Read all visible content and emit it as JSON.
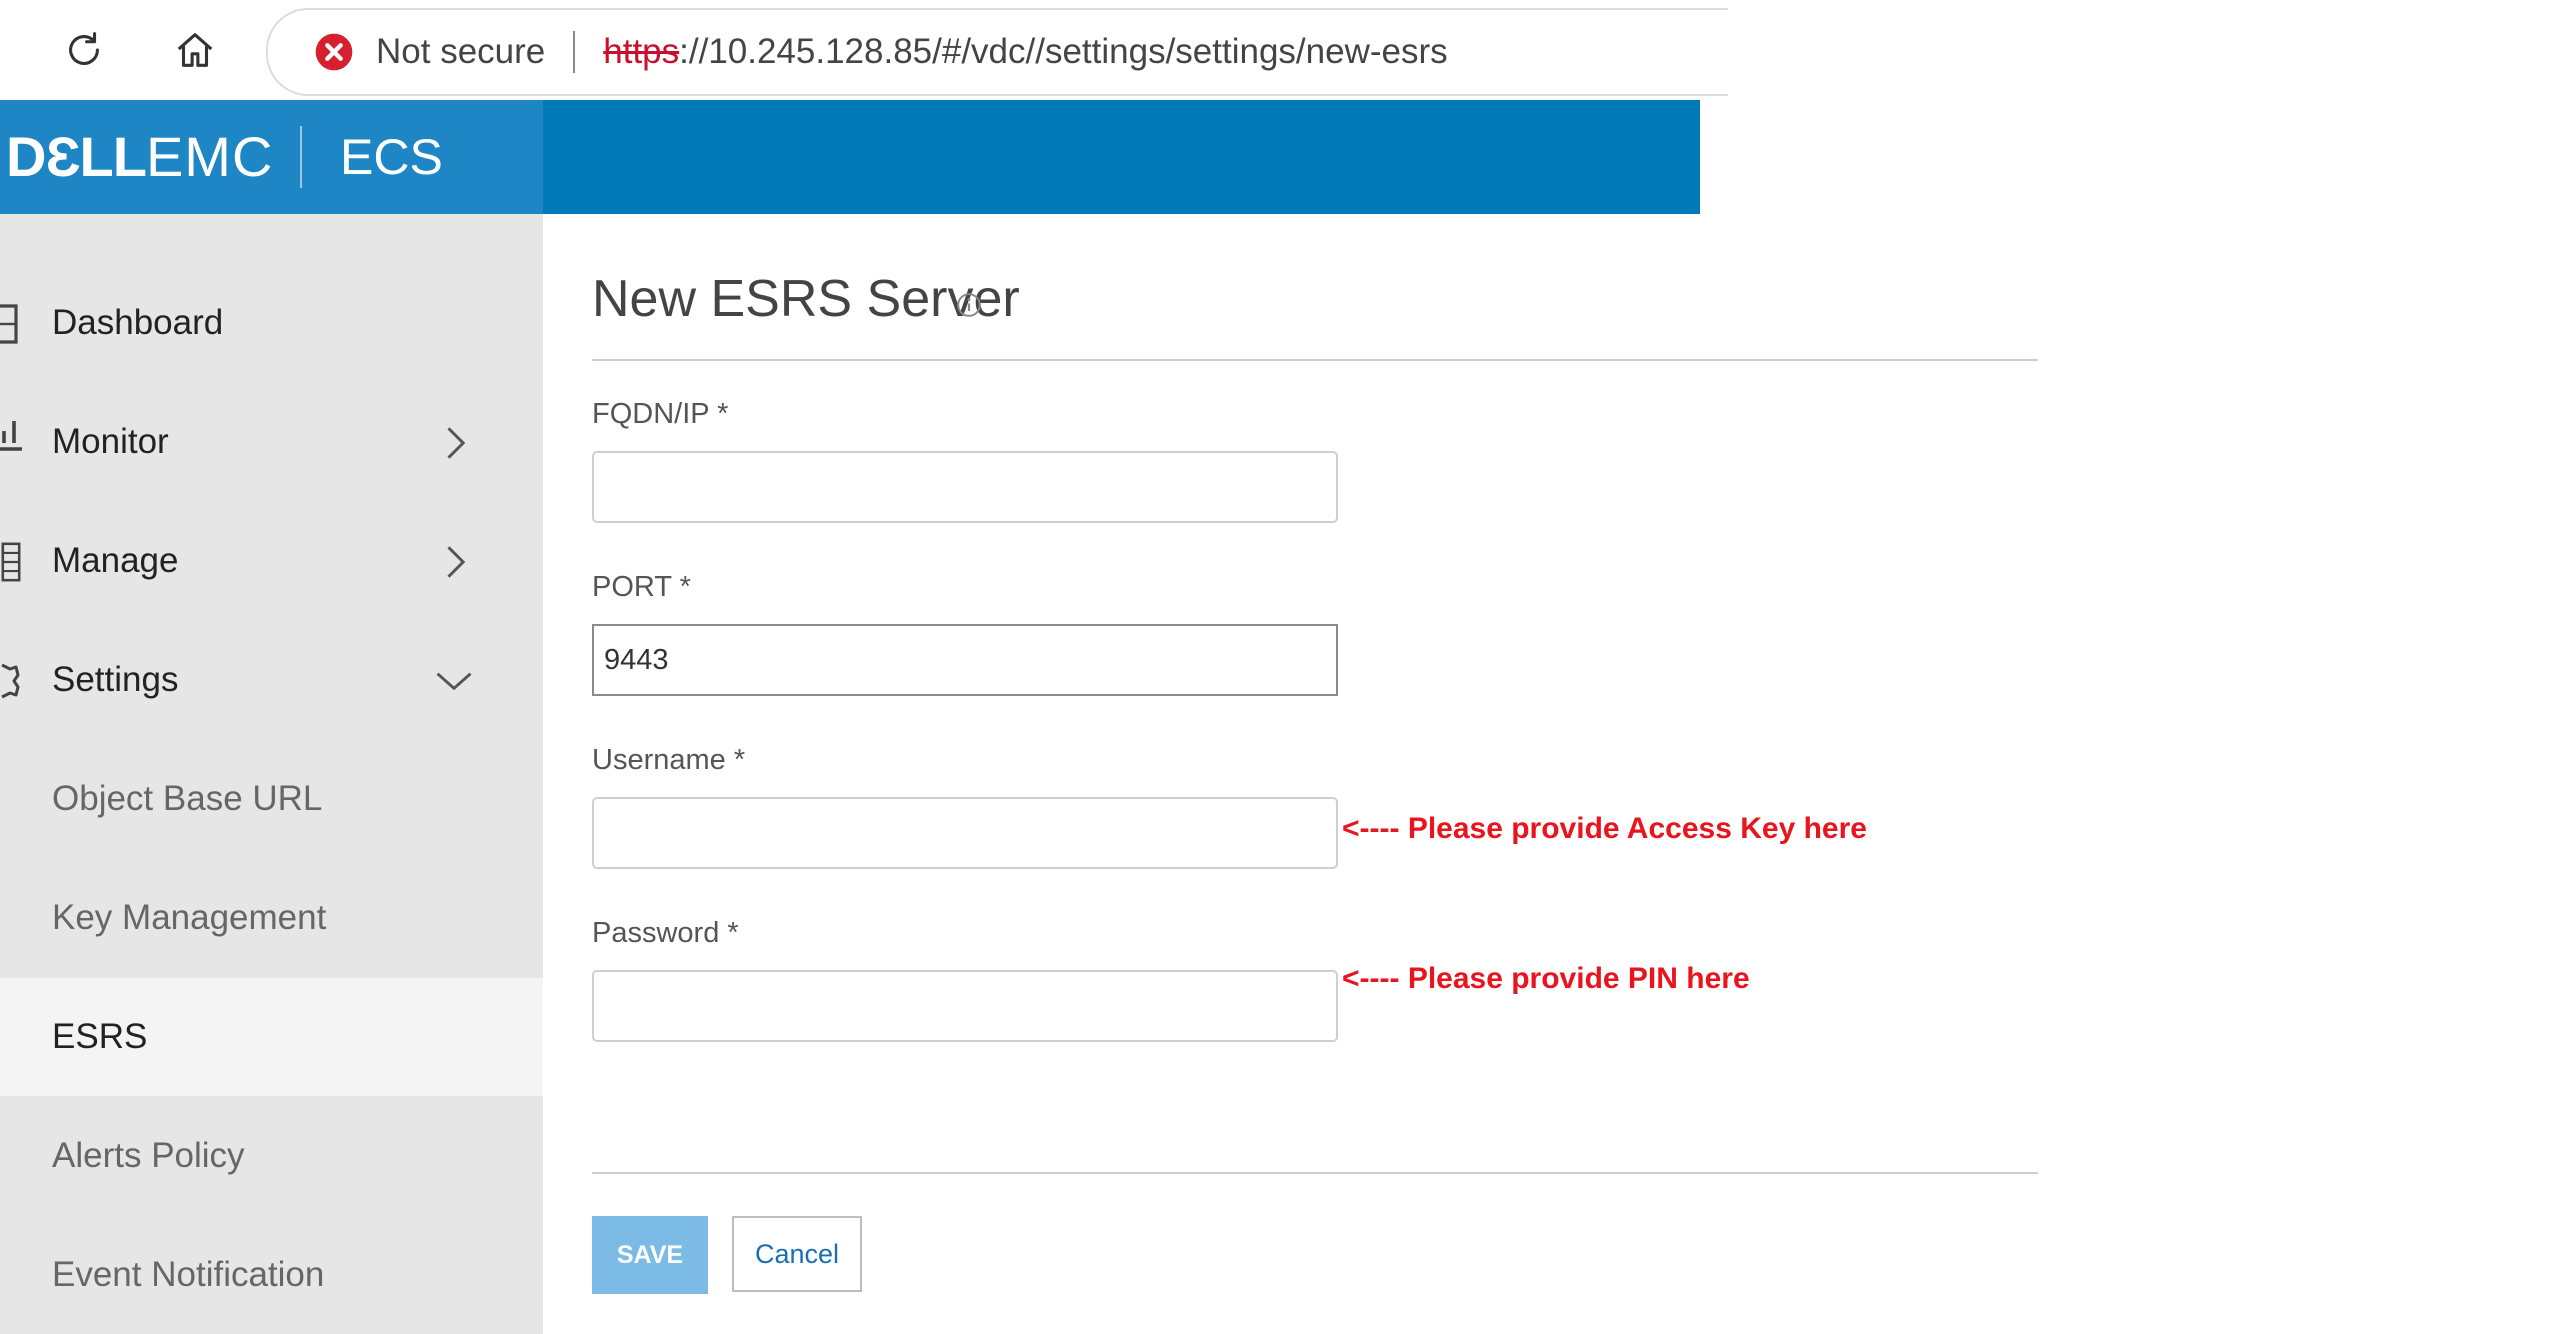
{
  "browser": {
    "security_text": "Not secure",
    "url_scheme": "https",
    "url_rest": "://10.245.128.85/#/vdc//settings/settings/new-esrs"
  },
  "header": {
    "logo_bold": "DƐLL",
    "logo_light": "EMC",
    "product": "ECS",
    "brand_color": "#007ab8"
  },
  "sidebar": {
    "items": [
      {
        "label": "Dashboard",
        "icon": "dashboard-icon"
      },
      {
        "label": "Monitor",
        "icon": "monitor-icon"
      },
      {
        "label": "Manage",
        "icon": "manage-icon"
      },
      {
        "label": "Settings",
        "icon": "settings-icon"
      },
      {
        "label": "Object Base URL"
      },
      {
        "label": "Key Management"
      },
      {
        "label": "ESRS"
      },
      {
        "label": "Alerts Policy"
      },
      {
        "label": "Event Notification"
      }
    ]
  },
  "main": {
    "title": "New ESRS Server",
    "fields": [
      {
        "label": "FQDN/IP *",
        "value": ""
      },
      {
        "label": "PORT *",
        "value": "9443"
      },
      {
        "label": "Username *",
        "value": ""
      },
      {
        "label": "Password *",
        "value": ""
      }
    ],
    "hints": {
      "username": "<---- Please provide Access Key here",
      "password": "<---- Please provide PIN here"
    },
    "save_label": "SAVE",
    "cancel_label": "Cancel"
  }
}
